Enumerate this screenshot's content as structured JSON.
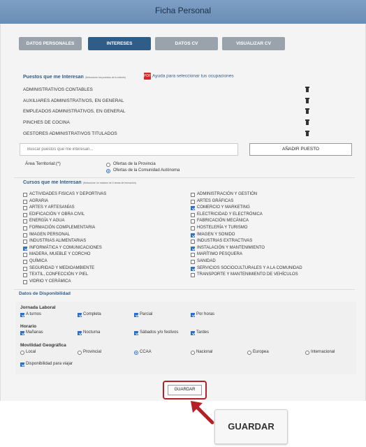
{
  "header": {
    "title": "Ficha Personal"
  },
  "tabs": [
    {
      "label": "DATOS PERSONALES",
      "active": false
    },
    {
      "label": "INTERESES",
      "active": true
    },
    {
      "label": "DATOS CV",
      "active": false
    },
    {
      "label": "VISUALIZAR CV",
      "active": false
    }
  ],
  "puestos": {
    "title": "Puestos que me Interesan",
    "note": "(Seleccione los puestos de tu interés)",
    "help_link": "Ayuda para seleccionar tus ocupaciones",
    "items": [
      "ADMINISTRATIVOS CONTABLES",
      "AUXILIARES ADMINISTRATIVOS, EN GENERAL",
      "EMPLEADOS ADMINISTRATIVOS, EN GENERAL",
      "PINCHES DE COCINA",
      "GESTORES ADMINISTRATIVOS TITULADOS"
    ],
    "search_placeholder": "Buscar puestos que me interesan...",
    "add_button": "AÑADIR PUESTO"
  },
  "area": {
    "label": "Área Territorial:(*)",
    "options": [
      {
        "label": "Ofertas de la Provincia",
        "selected": false
      },
      {
        "label": "Ofertas de la Comunidad Autónoma",
        "selected": true
      }
    ]
  },
  "cursos": {
    "title": "Cursos que me Interesan",
    "note": "(Seleccione un máximo de 5 áreas de formación)",
    "left": [
      {
        "label": "ACTIVIDADES FISICAS Y DEPORTIVAS",
        "checked": false
      },
      {
        "label": "AGRARIA",
        "checked": false
      },
      {
        "label": "ARTES Y ARTESANÍAS",
        "checked": false
      },
      {
        "label": "EDIFICACIÓN Y OBRA CIVIL",
        "checked": false
      },
      {
        "label": "ENERGÍA Y AGUA",
        "checked": false
      },
      {
        "label": "FORMACIÓN COMPLEMENTARIA",
        "checked": false
      },
      {
        "label": "IMAGEN PERSONAL",
        "checked": false
      },
      {
        "label": "INDUSTRIAS ALIMENTARIAS",
        "checked": false
      },
      {
        "label": "INFORMÁTICA Y COMUNICACIONES",
        "checked": true
      },
      {
        "label": "MADERA, MUEBLE Y CORCHO",
        "checked": false
      },
      {
        "label": "QUÍMICA",
        "checked": false
      },
      {
        "label": "SEGURIDAD Y MEDIOAMBIENTE",
        "checked": false
      },
      {
        "label": "TEXTIL, CONFECCIÓN Y PIEL",
        "checked": false
      },
      {
        "label": "VIDRIO Y CERÁMICA",
        "checked": false
      }
    ],
    "right": [
      {
        "label": "ADMINISTRACIÓN Y GESTIÓN",
        "checked": false
      },
      {
        "label": "ARTES GRÁFICAS",
        "checked": false
      },
      {
        "label": "COMERCIO Y MARKETING",
        "checked": true
      },
      {
        "label": "ELECTRICIDAD Y ELECTRÓNICA",
        "checked": false
      },
      {
        "label": "FABRICACIÓN MECÁNICA",
        "checked": false
      },
      {
        "label": "HOSTELERÍA Y TURISMO",
        "checked": false
      },
      {
        "label": "IMAGEN Y SONIDO",
        "checked": true
      },
      {
        "label": "INDUSTRIAS EXTRACTIVAS",
        "checked": false
      },
      {
        "label": "INSTALACIÓN Y MANTENIMIENTO",
        "checked": true
      },
      {
        "label": "MARÍTIMO PESQUERA",
        "checked": false
      },
      {
        "label": "SANIDAD",
        "checked": false
      },
      {
        "label": "SERVICIOS SOCIOCULTURALES Y A LA COMUNIDAD",
        "checked": true
      },
      {
        "label": "TRANSPORTE Y MANTENIMIENTO DE VEHÍCULOS",
        "checked": false
      }
    ]
  },
  "disponibilidad": {
    "title": "Datos de Disponibilidad",
    "jornada": {
      "label": "Jornada Laboral",
      "options": [
        {
          "label": "A turnos",
          "checked": true
        },
        {
          "label": "Completa",
          "checked": true
        },
        {
          "label": "Parcial",
          "checked": true
        },
        {
          "label": "Por horas",
          "checked": true
        }
      ]
    },
    "horario": {
      "label": "Horario",
      "options": [
        {
          "label": "Mañanas",
          "checked": true
        },
        {
          "label": "Nocturna",
          "checked": true
        },
        {
          "label": "Sábados y/o festivos",
          "checked": true
        },
        {
          "label": "Tardes",
          "checked": true
        }
      ]
    },
    "movilidad": {
      "label": "Movilidad Geográfica",
      "options": [
        {
          "label": "Local",
          "selected": false
        },
        {
          "label": "Provincial",
          "selected": false
        },
        {
          "label": "CCAA",
          "selected": true
        },
        {
          "label": "Nacional",
          "selected": false
        },
        {
          "label": "Europea",
          "selected": false
        },
        {
          "label": "Internacional",
          "selected": false
        }
      ]
    },
    "viajar": {
      "label": "Disponibilidad para viajar",
      "checked": true
    }
  },
  "actions": {
    "save": "GUARDAR",
    "save_zoom": "GUARDAR"
  },
  "colors": {
    "accent": "#2f5d88",
    "highlight": "#b32025",
    "header": "#7d9fc4"
  }
}
